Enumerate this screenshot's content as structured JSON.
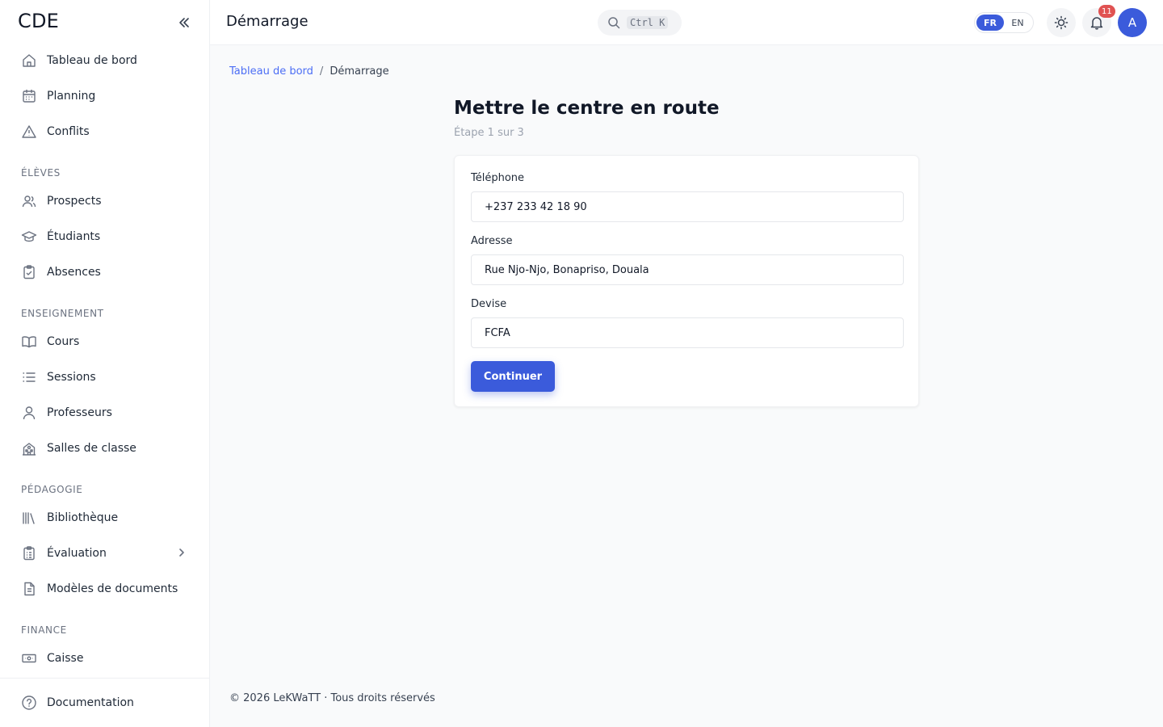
{
  "sidebar": {
    "brand": "CDE",
    "items_top": [
      {
        "label": "Tableau de bord",
        "icon": "home-icon"
      },
      {
        "label": "Planning",
        "icon": "calendar-icon"
      },
      {
        "label": "Conflits",
        "icon": "warning-icon"
      }
    ],
    "section_eleves": "ÉLÈVES",
    "items_eleves": [
      {
        "label": "Prospects",
        "icon": "users-icon"
      },
      {
        "label": "Étudiants",
        "icon": "graduation-cap-icon"
      },
      {
        "label": "Absences",
        "icon": "clipboard-check-icon"
      }
    ],
    "section_enseignement": "ENSEIGNEMENT",
    "items_enseignement": [
      {
        "label": "Cours",
        "icon": "book-open-icon"
      },
      {
        "label": "Sessions",
        "icon": "list-icon"
      },
      {
        "label": "Professeurs",
        "icon": "user-icon"
      },
      {
        "label": "Salles de classe",
        "icon": "building-icon"
      }
    ],
    "section_pedagogie": "PÉDAGOGIE",
    "items_pedagogie": [
      {
        "label": "Bibliothèque",
        "icon": "library-icon"
      },
      {
        "label": "Évaluation",
        "icon": "clipboard-list-icon"
      },
      {
        "label": "Modèles de documents",
        "icon": "document-icon"
      }
    ],
    "section_finance": "FINANCE",
    "items_finance": [
      {
        "label": "Caisse",
        "icon": "cash-icon"
      }
    ],
    "footer_item": {
      "label": "Documentation",
      "icon": "help-circle-icon"
    }
  },
  "topbar": {
    "title": "Démarrage",
    "search_shortcut": "Ctrl K",
    "lang_active": "FR",
    "lang_inactive": "EN",
    "notifications_count": "11",
    "avatar_initial": "A"
  },
  "breadcrumb": {
    "root": "Tableau de bord",
    "separator": "/",
    "current": "Démarrage"
  },
  "main": {
    "heading": "Mettre le centre en route",
    "step": "Étape 1 sur 3",
    "form": {
      "phone_label": "Téléphone",
      "phone_value": "+237 233 42 18 90",
      "address_label": "Adresse",
      "address_value": "Rue Njo-Njo, Bonapriso, Douala",
      "currency_label": "Devise",
      "currency_value": "FCFA",
      "submit_label": "Continuer"
    }
  },
  "footer": {
    "text": "© 2026 LeKWaTT · Tous droits réservés"
  },
  "colors": {
    "accent": "#3b5bdb",
    "link": "#4c6ef5",
    "badge": "#e05252"
  }
}
